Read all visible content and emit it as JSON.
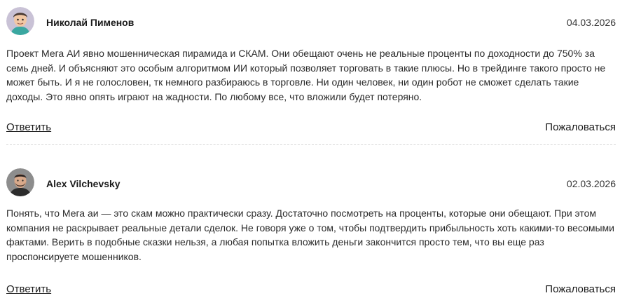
{
  "comments": [
    {
      "author": "Николай Пименов",
      "date": "04.03.2026",
      "text": "Проект Мега АИ явно мошенническая пирамида и СКАМ. Они обещают очень не реальные проценты по доходности до 750% за семь дней. И объясняют это особым алгоритмом ИИ который позволяет торговать в такие плюсы. Но в трейдинге такого просто не может быть. И я не голословен, тк немного разбираюсь в торговле. Ни один человек, ни один робот не сможет сделать такие доходы. Это явно опять играют на жадности. По любому все, что вложили будет потеряно.",
      "reply_label": "Ответить",
      "report_label": "Пожаловаться"
    },
    {
      "author": "Alex Vilchevsky",
      "date": "02.03.2026",
      "text": "Понять, что Мега аи — это скам можно практически сразу. Достаточно посмотреть на проценты, которые они обещают. При этом компания не раскрывает реальные детали сделок. Не говоря уже о том, чтобы подтвердить прибыльность хоть какими-то весомыми фактами. Верить в подобные сказки нельзя, а любая попытка вложить деньги закончится просто тем, что вы еще раз проспонсируете мошенников.",
      "reply_label": "Ответить",
      "report_label": "Пожаловаться"
    }
  ]
}
